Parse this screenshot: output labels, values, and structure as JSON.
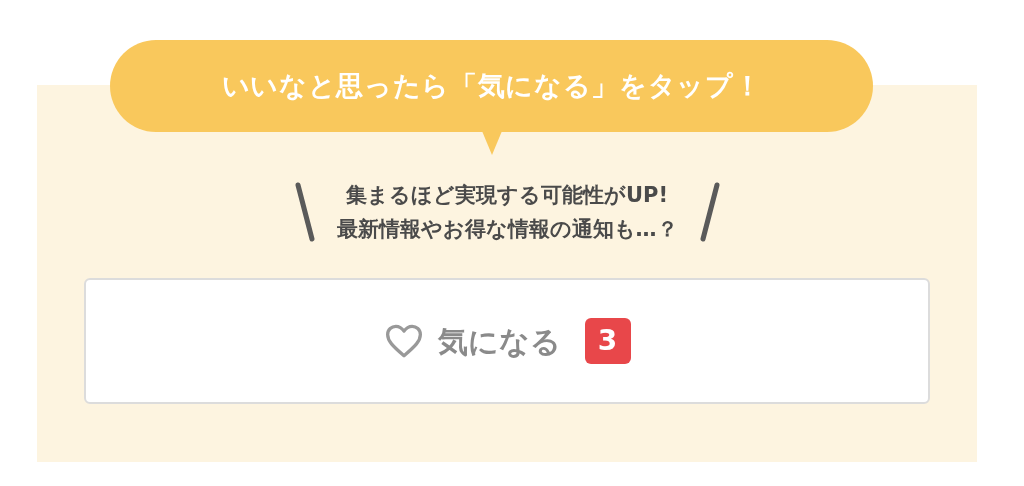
{
  "callout": {
    "text": "いいなと思ったら「気になる」をタップ！"
  },
  "message": {
    "lines": [
      "集まるほど実現する可能性がUP!",
      "最新情報やお得な情報の通知も…？"
    ]
  },
  "like_button": {
    "label": "気になる",
    "count": "3"
  }
}
